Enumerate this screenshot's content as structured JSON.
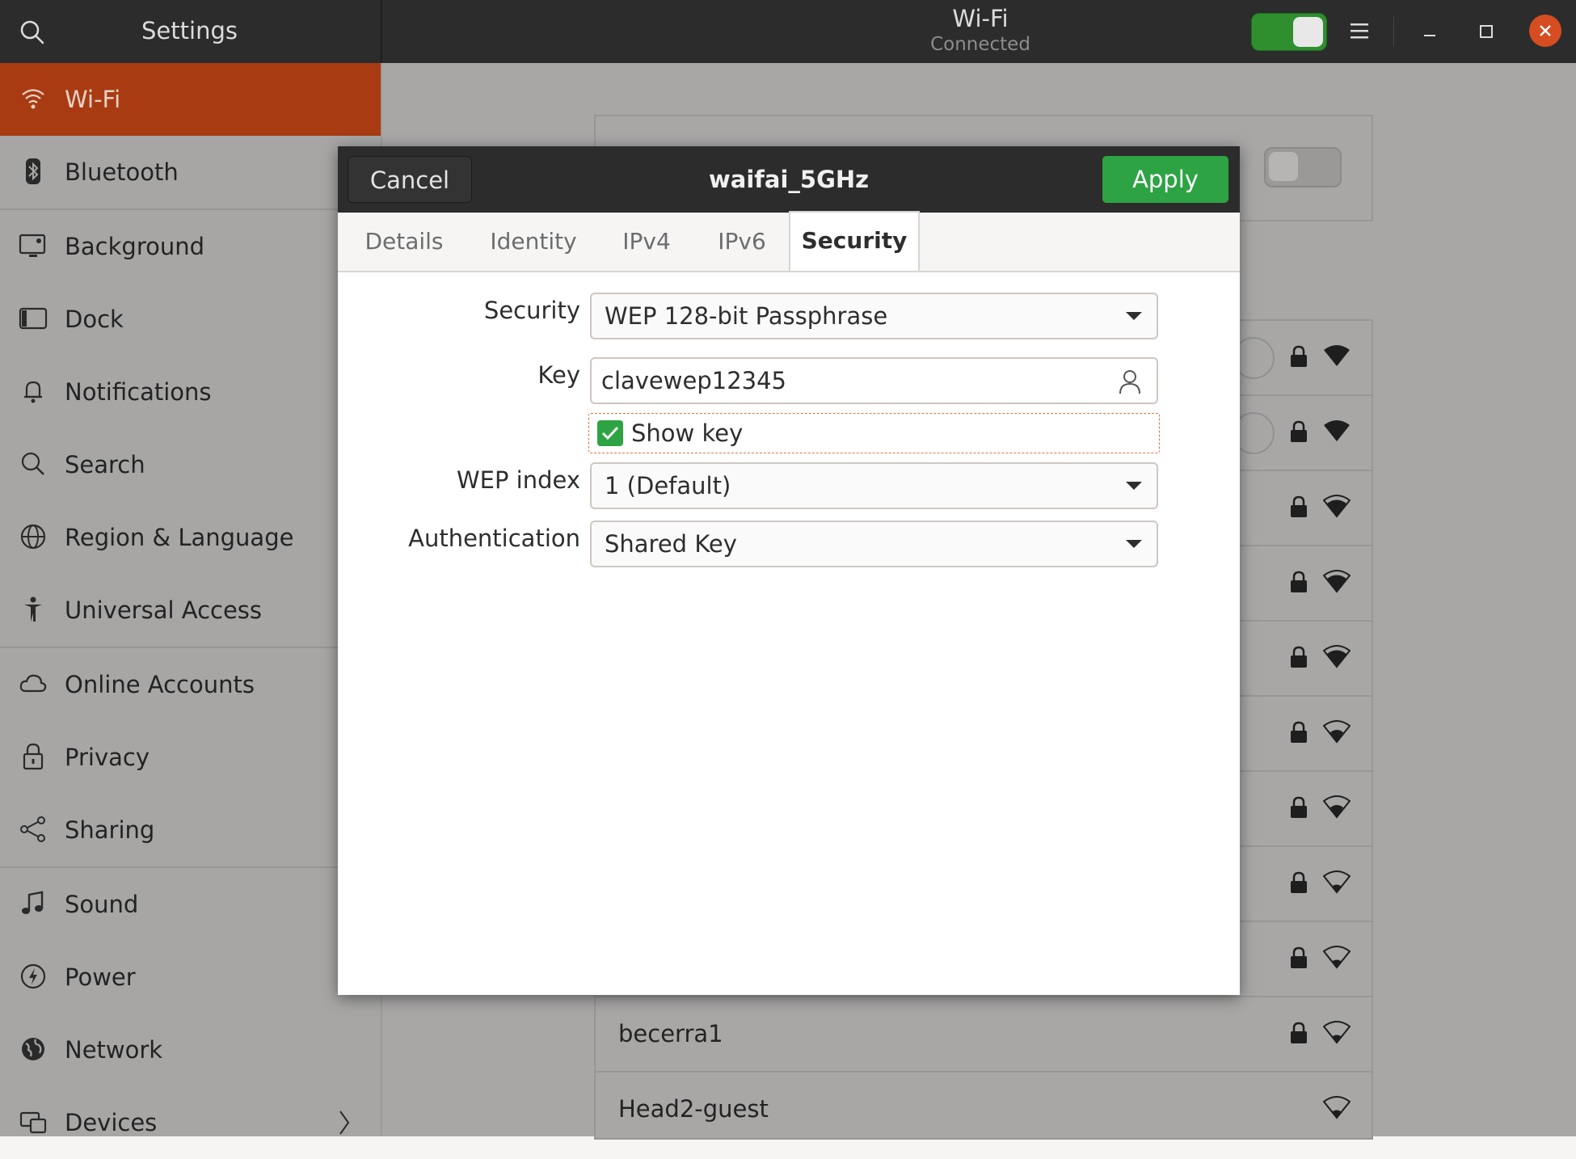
{
  "header": {
    "app_title": "Settings",
    "panel_title": "Wi-Fi",
    "panel_subtitle": "Connected",
    "wifi_toggle_on": true
  },
  "sidebar": {
    "items": [
      {
        "label": "Wi-Fi",
        "icon": "wifi-icon",
        "active": true
      },
      {
        "label": "Bluetooth",
        "icon": "bluetooth-icon"
      },
      {
        "label": "Background",
        "icon": "background-icon"
      },
      {
        "label": "Dock",
        "icon": "dock-icon"
      },
      {
        "label": "Notifications",
        "icon": "bell-icon"
      },
      {
        "label": "Search",
        "icon": "search-icon"
      },
      {
        "label": "Region & Language",
        "icon": "globe-icon"
      },
      {
        "label": "Universal Access",
        "icon": "accessibility-icon"
      },
      {
        "label": "Online Accounts",
        "icon": "cloud-icon"
      },
      {
        "label": "Privacy",
        "icon": "lock-icon"
      },
      {
        "label": "Sharing",
        "icon": "share-icon"
      },
      {
        "label": "Sound",
        "icon": "music-note-icon"
      },
      {
        "label": "Power",
        "icon": "power-icon"
      },
      {
        "label": "Network",
        "icon": "network-icon"
      },
      {
        "label": "Devices",
        "icon": "devices-icon"
      }
    ]
  },
  "networks": {
    "visible_names": [
      "becerra1",
      "Head2-guest"
    ]
  },
  "dialog": {
    "cancel_label": "Cancel",
    "title": "waifai_5GHz",
    "apply_label": "Apply",
    "tabs": [
      "Details",
      "Identity",
      "IPv4",
      "IPv6",
      "Security"
    ],
    "selected_tab": "Security",
    "form": {
      "security_label": "Security",
      "security_value": "WEP 128-bit Passphrase",
      "key_label": "Key",
      "key_value": "clavewep12345",
      "show_key_label": "Show key",
      "show_key_checked": true,
      "wep_index_label": "WEP index",
      "wep_index_value": "1 (Default)",
      "auth_label": "Authentication",
      "auth_value": "Shared Key"
    }
  },
  "colors": {
    "accent_orange": "#a93b12",
    "apply_green": "#2ea344",
    "header_dark": "#2c2c2c",
    "close_orange": "#d54d21"
  }
}
